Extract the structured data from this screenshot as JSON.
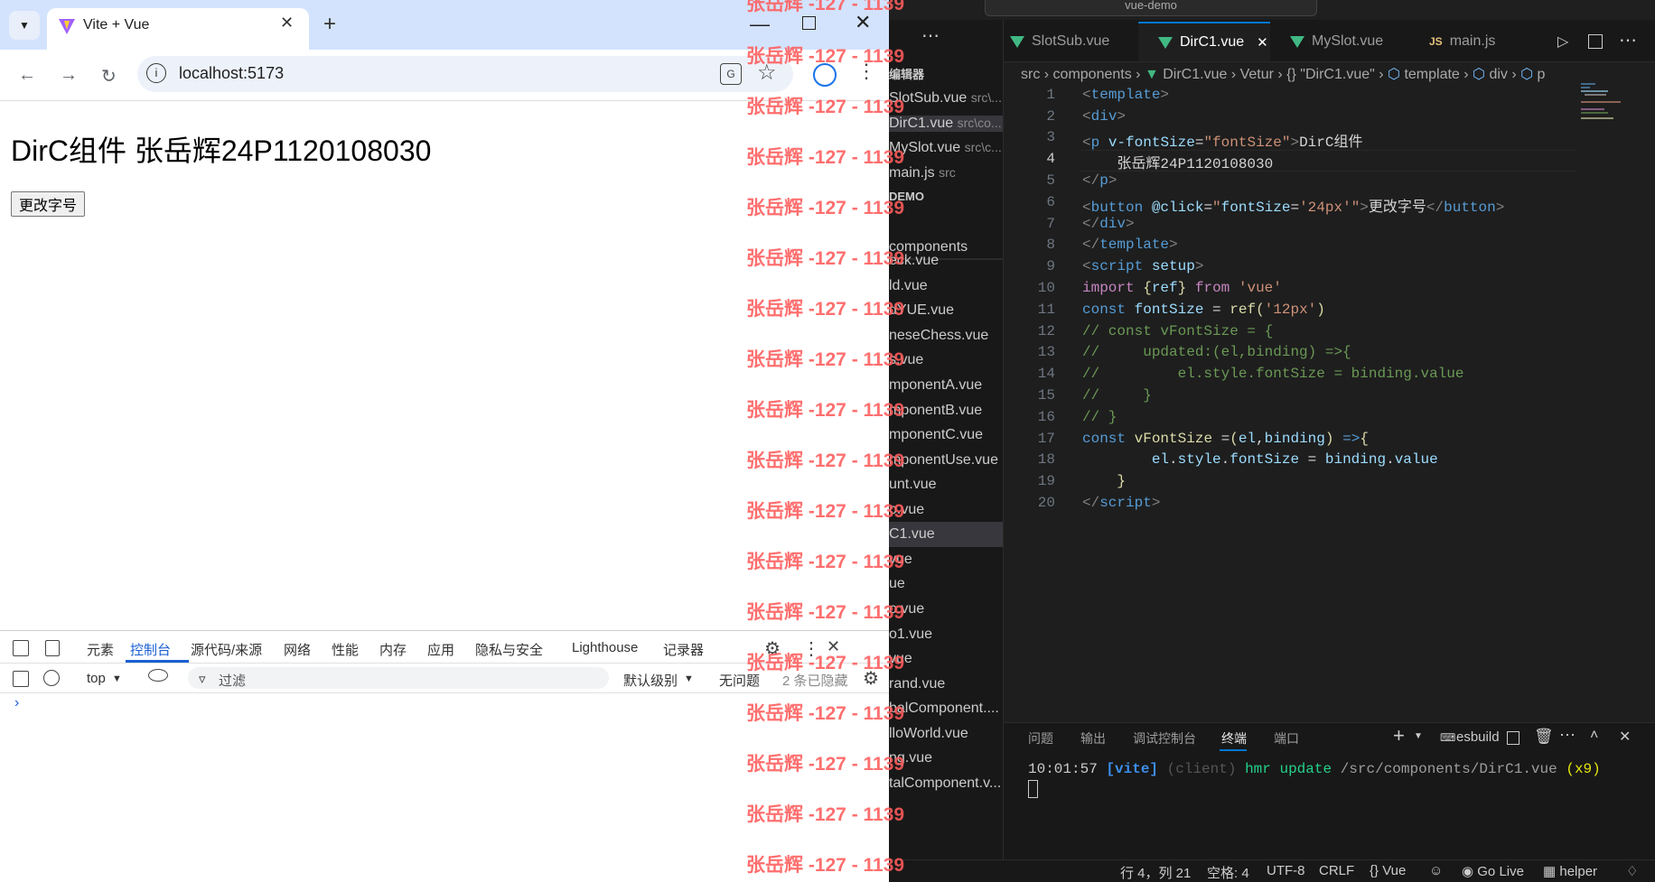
{
  "browser": {
    "tab_title": "Vite + Vue",
    "url": "localhost:5173",
    "page": {
      "heading": "DirC组件 张岳辉24P1120108030",
      "button_label": "更改字号"
    },
    "devtools": {
      "tabs": [
        "元素",
        "控制台",
        "源代码/来源",
        "网络",
        "性能",
        "内存",
        "应用",
        "隐私与安全",
        "Lighthouse",
        "记录器"
      ],
      "context": "top",
      "filter_placeholder": "过滤",
      "level": "默认级别",
      "issues": "无问题",
      "hidden": "2 条已隐藏",
      "prompt": "›"
    }
  },
  "watermark": "张岳辉 -127 - 1139",
  "vscode": {
    "search": "vue-demo",
    "sidebar": {
      "header": "编辑器",
      "open_editors": [
        {
          "name": "SlotSub.vue",
          "path": "src\\..."
        },
        {
          "name": "DirC1.vue",
          "path": "src\\co..."
        },
        {
          "name": "MySlot.vue",
          "path": "src\\c..."
        },
        {
          "name": "main.js",
          "path": "src"
        }
      ],
      "section": "DEMO",
      "folder": "components",
      "files": [
        "eck.vue",
        "ld.vue",
        "dYUE.vue",
        "neseChess.vue",
        "s.vue",
        "mponentA.vue",
        "mponentB.vue",
        "mponentC.vue",
        "mponentUse.vue",
        "unt.vue",
        "o.vue",
        "C1.vue",
        "vue",
        "ue",
        "o.vue",
        "o1.vue",
        "vue",
        "rand.vue",
        "balComponent....",
        "lloWorld.vue",
        "ng.vue",
        "talComponent.v..."
      ]
    },
    "tabs": [
      "SlotSub.vue",
      "DirC1.vue",
      "MySlot.vue",
      "main.js"
    ],
    "breadcrumb": [
      "src",
      "components",
      "DirC1.vue",
      "Vetur",
      "{} \"DirC1.vue\"",
      "template",
      "div",
      "p"
    ],
    "code_lines": [
      "1",
      "2",
      "3",
      "4",
      "5",
      "6",
      "7",
      "8",
      "9",
      "10",
      "11",
      "12",
      "13",
      "14",
      "15",
      "16",
      "17",
      "18",
      "19",
      "20"
    ],
    "code_text": {
      "l3_text": "DirC组件",
      "l4_text": "张岳辉24P1120108030",
      "l6_text": "更改字号"
    },
    "panel": {
      "tabs": [
        "问题",
        "输出",
        "调试控制台",
        "终端",
        "端口"
      ],
      "terminal_name": "esbuild",
      "time": "10:01:57",
      "vite": "[vite]",
      "client": "(client)",
      "msg": "hmr update",
      "file": "/src/components/DirC1.vue",
      "count": "(x9)"
    },
    "status": {
      "position": "行 4，列 21",
      "spaces": "空格: 4",
      "encoding": "UTF-8",
      "eol": "CRLF",
      "language": "Vue",
      "golive": "Go Live",
      "helper": "helper"
    }
  }
}
